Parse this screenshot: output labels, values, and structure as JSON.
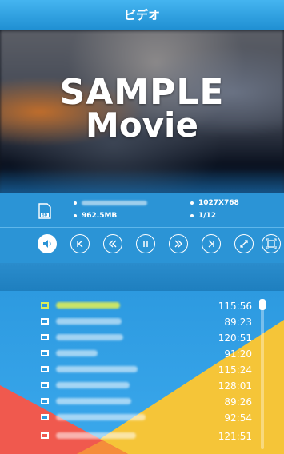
{
  "header": {
    "title": "ビデオ"
  },
  "video": {
    "line1": "SAMPLE",
    "line2": "Movie"
  },
  "info": {
    "storage_icon": "sd-card-icon",
    "file_size": "962.5MB",
    "resolution": "1027X768",
    "position": "1/12"
  },
  "controls": [
    {
      "name": "volume-button",
      "icon": "volume-icon"
    },
    {
      "name": "previous-button",
      "icon": "skip-previous-icon"
    },
    {
      "name": "rewind-button",
      "icon": "rewind-icon"
    },
    {
      "name": "pause-button",
      "icon": "pause-icon"
    },
    {
      "name": "fast-forward-button",
      "icon": "fast-forward-icon"
    },
    {
      "name": "next-button",
      "icon": "skip-next-icon"
    },
    {
      "name": "fullscreen-button",
      "icon": "expand-icon"
    },
    {
      "name": "aspect-button",
      "icon": "aspect-ratio-icon"
    }
  ],
  "playlist": {
    "items": [
      {
        "duration": "115:56",
        "selected": true
      },
      {
        "duration": "89:23",
        "selected": false
      },
      {
        "duration": "120:51",
        "selected": false
      },
      {
        "duration": "91:20",
        "selected": false
      },
      {
        "duration": "115:24",
        "selected": false
      },
      {
        "duration": "128:01",
        "selected": false
      },
      {
        "duration": "89:26",
        "selected": false
      },
      {
        "duration": "92:54",
        "selected": false
      },
      {
        "duration": "121:51",
        "selected": false
      }
    ]
  },
  "colors": {
    "accent": "#2b94d6",
    "selected_text": "#daec5a",
    "yellow": "#f5c538",
    "red": "#f0594e"
  }
}
